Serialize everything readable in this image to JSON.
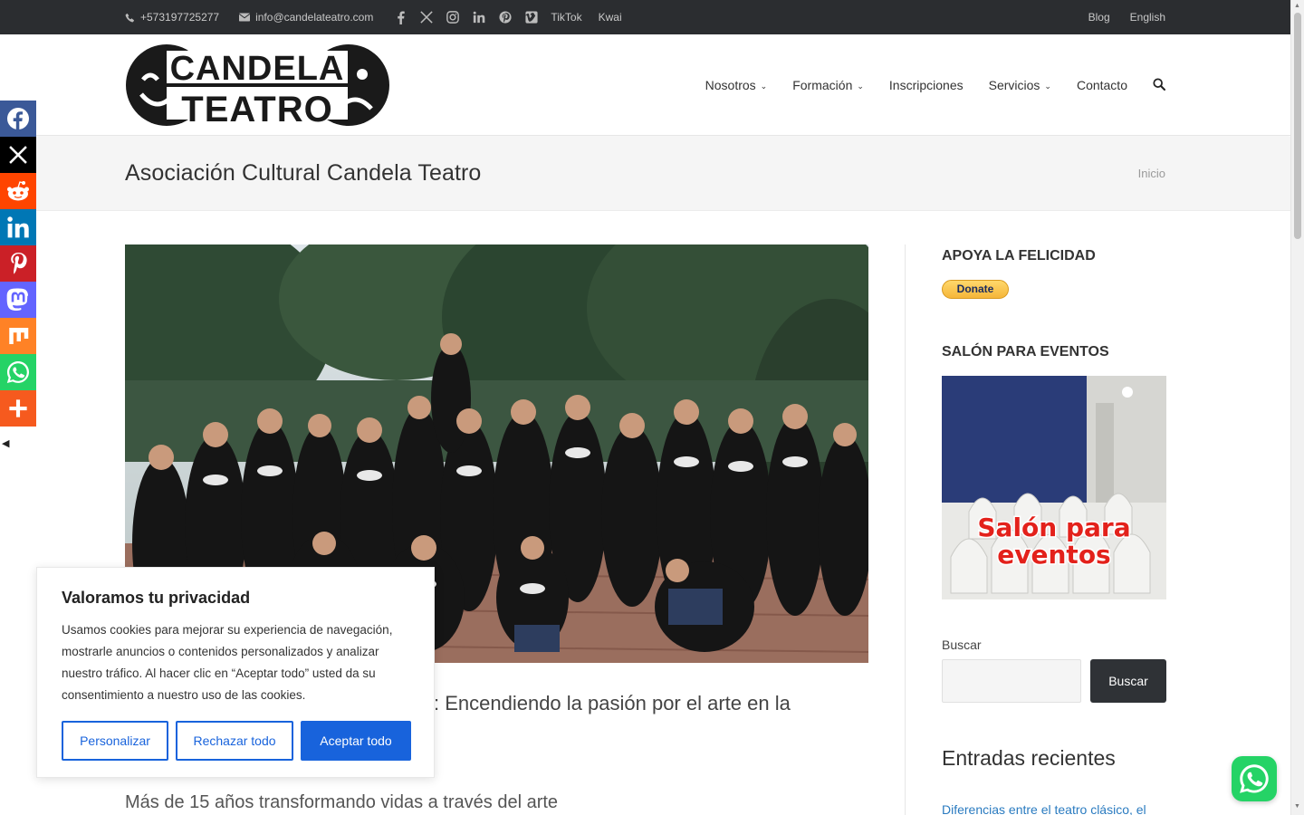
{
  "topbar": {
    "phone": "+573197725277",
    "email": "info@candelateatro.com",
    "social_icons": [
      "facebook-icon",
      "x-icon",
      "instagram-icon",
      "linkedin-icon",
      "pinterest-icon",
      "vimeo-icon"
    ],
    "tiktok": "TikTok",
    "kwai": "Kwai",
    "blog": "Blog",
    "language": "English"
  },
  "logo": {
    "line1": "CANDELA",
    "line2": "TEATRO"
  },
  "nav": {
    "items": [
      {
        "label": "Nosotros",
        "dropdown": true
      },
      {
        "label": "Formación",
        "dropdown": true
      },
      {
        "label": "Inscripciones",
        "dropdown": false
      },
      {
        "label": "Servicios",
        "dropdown": true
      },
      {
        "label": "Contacto",
        "dropdown": false
      }
    ],
    "chevron": "⌄"
  },
  "page": {
    "title": "Asociación Cultural Candela Teatro",
    "breadcrumb": "Inicio"
  },
  "article": {
    "title_visible": ": Encendiendo la pasión por el arte en la",
    "subtitle": "Más de 15 años transformando vidas a través del arte"
  },
  "sidebar": {
    "support_heading": "APOYA LA FELICIDAD",
    "donate_label": "Donate",
    "events_heading": "SALÓN PARA EVENTOS",
    "events_image_text_1": "Salón para",
    "events_image_text_2": "eventos",
    "search_label": "Buscar",
    "search_button": "Buscar",
    "recent_heading": "Entradas recientes",
    "recent_link": "Diferencias entre el teatro clásico, el"
  },
  "share_bar": {
    "buttons": [
      {
        "name": "facebook",
        "color": "#3b5998"
      },
      {
        "name": "x",
        "color": "#000000"
      },
      {
        "name": "reddit",
        "color": "#ff4500"
      },
      {
        "name": "linkedin",
        "color": "#0077b5"
      },
      {
        "name": "pinterest",
        "color": "#cb2027"
      },
      {
        "name": "mastodon",
        "color": "#6364ff"
      },
      {
        "name": "mix",
        "color": "#ff8226"
      },
      {
        "name": "whatsapp",
        "color": "#25d366"
      },
      {
        "name": "more",
        "color": "#f65a1e"
      }
    ]
  },
  "cookie": {
    "title": "Valoramos tu privacidad",
    "body": "Usamos cookies para mejorar su experiencia de navegación, mostrarle anuncios o contenidos personalizados y analizar nuestro tráfico. Al hacer clic en “Aceptar todo” usted da su consentimiento a nuestro uso de las cookies.",
    "customize": "Personalizar",
    "reject": "Rechazar todo",
    "accept": "Aceptar todo"
  },
  "colors": {
    "topbar_bg": "#2b2d30",
    "accent_blue": "#1863dc",
    "whatsapp": "#25d366"
  }
}
